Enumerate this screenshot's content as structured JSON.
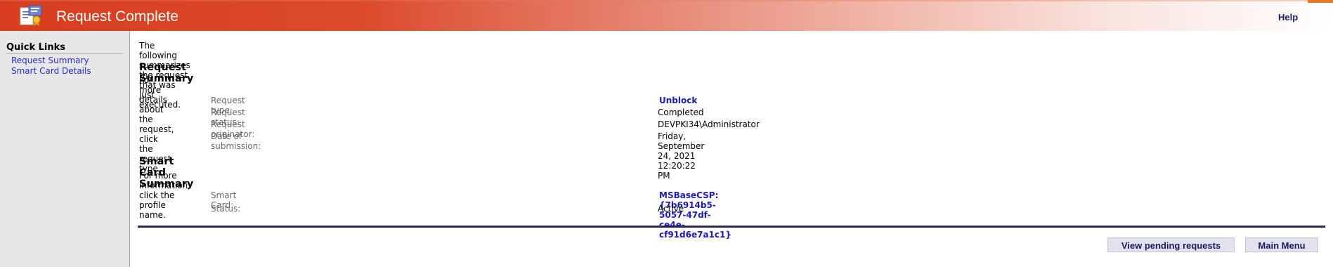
{
  "header": {
    "title": "Request Complete",
    "help_label": "Help",
    "logo_icon": "certificate-document-icon"
  },
  "sidebar": {
    "title": "Quick Links",
    "links": [
      {
        "label": "Request Summary"
      },
      {
        "label": "Smart Card Details"
      }
    ]
  },
  "main": {
    "intro": "The following summarizes the request that was just executed.",
    "request_summary": {
      "title": "Request Summary",
      "description": "For more details about the request, click the request type.",
      "rows": [
        {
          "label": "Request type:",
          "value": "Unblock"
        },
        {
          "label": "Request status:",
          "value": "Completed"
        },
        {
          "label": "Request originator:",
          "value": "DEVPKI34\\Administrator"
        },
        {
          "label": "Date of submission:",
          "value": "Friday, September 24, 2021 12:20:22 PM"
        }
      ]
    },
    "smart_card_summary": {
      "title": "Smart Card Summary",
      "description": "For more information, click the profile name.",
      "rows": [
        {
          "label": "Smart Card:",
          "value": "MSBaseCSP:{7b6914b5-5057-47df-ce4e-cf91d6e7a1c1}"
        },
        {
          "label": "Status:",
          "value": "Active"
        }
      ]
    }
  },
  "buttons": {
    "view_pending": "View pending requests",
    "main_menu": "Main Menu"
  },
  "colors": {
    "header_red": "#d83d1f",
    "link_blue": "#1a1acc",
    "button_text": "#1a1a66"
  }
}
